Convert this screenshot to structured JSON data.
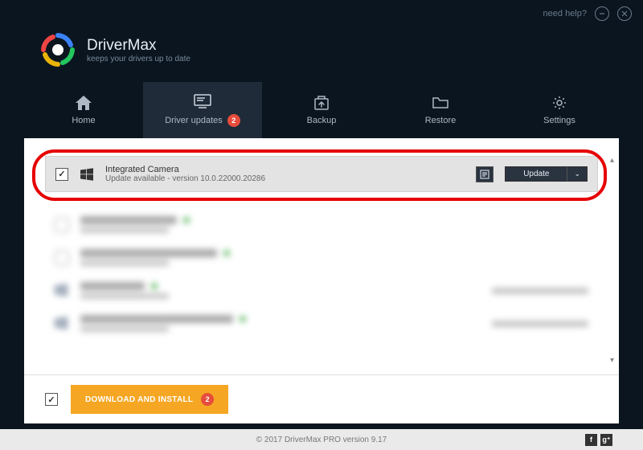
{
  "topbar": {
    "help": "need help?"
  },
  "brand": {
    "name": "DriverMax",
    "tagline": "keeps your drivers up to date"
  },
  "nav": {
    "home": "Home",
    "updates": "Driver updates",
    "updates_badge": "2",
    "backup": "Backup",
    "restore": "Restore",
    "settings": "Settings"
  },
  "driver": {
    "name": "Integrated Camera",
    "status": "Update available - version 10.0.22000.20286",
    "update_label": "Update"
  },
  "blurred": [
    {
      "name_w": 120,
      "kind": "monitor",
      "right": false
    },
    {
      "name_w": 170,
      "kind": "audio",
      "right": false
    },
    {
      "name_w": 80,
      "kind": "win",
      "right": true
    },
    {
      "name_w": 190,
      "kind": "win",
      "right": true
    }
  ],
  "install": {
    "label": "DOWNLOAD AND INSTALL",
    "badge": "2"
  },
  "footer": {
    "copyright": "© 2017 DriverMax PRO version 9.17"
  }
}
